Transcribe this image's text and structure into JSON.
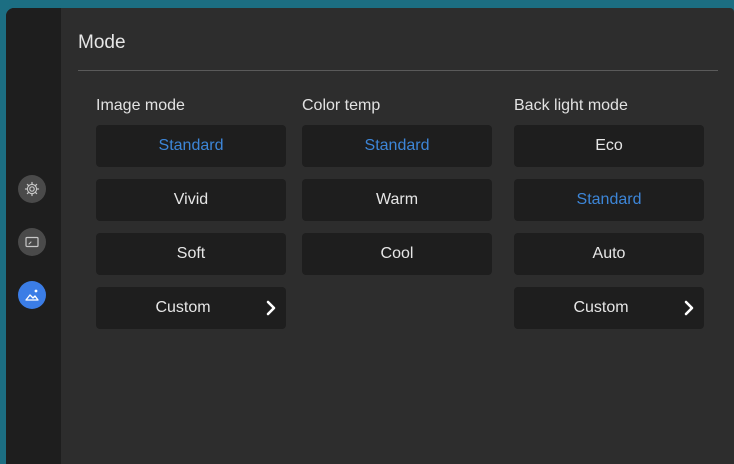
{
  "page": {
    "title": "Mode"
  },
  "columns": [
    {
      "heading": "Image mode",
      "options": [
        {
          "label": "Standard",
          "selected": true
        },
        {
          "label": "Vivid",
          "selected": false
        },
        {
          "label": "Soft",
          "selected": false
        },
        {
          "label": "Custom",
          "selected": false,
          "submenu": true
        }
      ]
    },
    {
      "heading": "Color temp",
      "options": [
        {
          "label": "Standard",
          "selected": true
        },
        {
          "label": "Warm",
          "selected": false
        },
        {
          "label": "Cool",
          "selected": false
        }
      ]
    },
    {
      "heading": "Back light mode",
      "options": [
        {
          "label": "Eco",
          "selected": false
        },
        {
          "label": "Standard",
          "selected": true
        },
        {
          "label": "Auto",
          "selected": false
        },
        {
          "label": "Custom",
          "selected": false,
          "submenu": true
        }
      ]
    }
  ],
  "sidebar": {
    "items": [
      {
        "icon": "gear-icon",
        "active": false
      },
      {
        "icon": "display-icon",
        "active": false
      },
      {
        "icon": "image-mode-icon",
        "active": true
      }
    ]
  },
  "colors": {
    "accent": "#3b7de6",
    "selected_text": "#3d86d8",
    "panel": "#2d2d2d",
    "button": "#1e1e1e"
  }
}
